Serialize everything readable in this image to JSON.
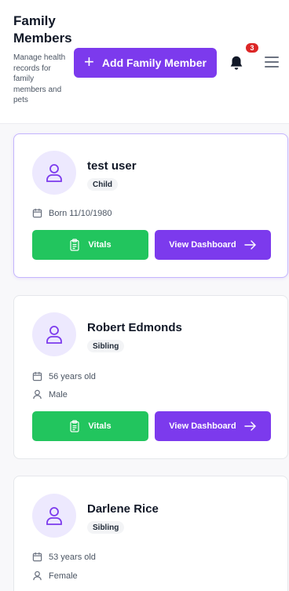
{
  "header": {
    "title_line1": "Family",
    "title_line2": "Members",
    "subtitle": "Manage health records for family members and pets",
    "add_button_label": "Add Family Member",
    "notification_count": "3"
  },
  "members": [
    {
      "name": "test user",
      "relationship": "Child",
      "details": [
        {
          "icon": "calendar-icon",
          "text": "Born 11/10/1980"
        }
      ],
      "vitals_label": "Vitals",
      "dashboard_label": "View Dashboard"
    },
    {
      "name": "Robert Edmonds",
      "relationship": "Sibling",
      "details": [
        {
          "icon": "calendar-icon",
          "text": "56 years old"
        },
        {
          "icon": "person-icon",
          "text": "Male"
        }
      ],
      "vitals_label": "Vitals",
      "dashboard_label": "View Dashboard"
    },
    {
      "name": "Darlene Rice",
      "relationship": "Sibling",
      "details": [
        {
          "icon": "calendar-icon",
          "text": "53 years old"
        },
        {
          "icon": "person-icon",
          "text": "Female"
        }
      ]
    }
  ],
  "colors": {
    "accent": "#7c3aed",
    "vitals_green": "#22c55e",
    "badge_red": "#dc2626",
    "avatar_bg": "#ede9fe"
  }
}
